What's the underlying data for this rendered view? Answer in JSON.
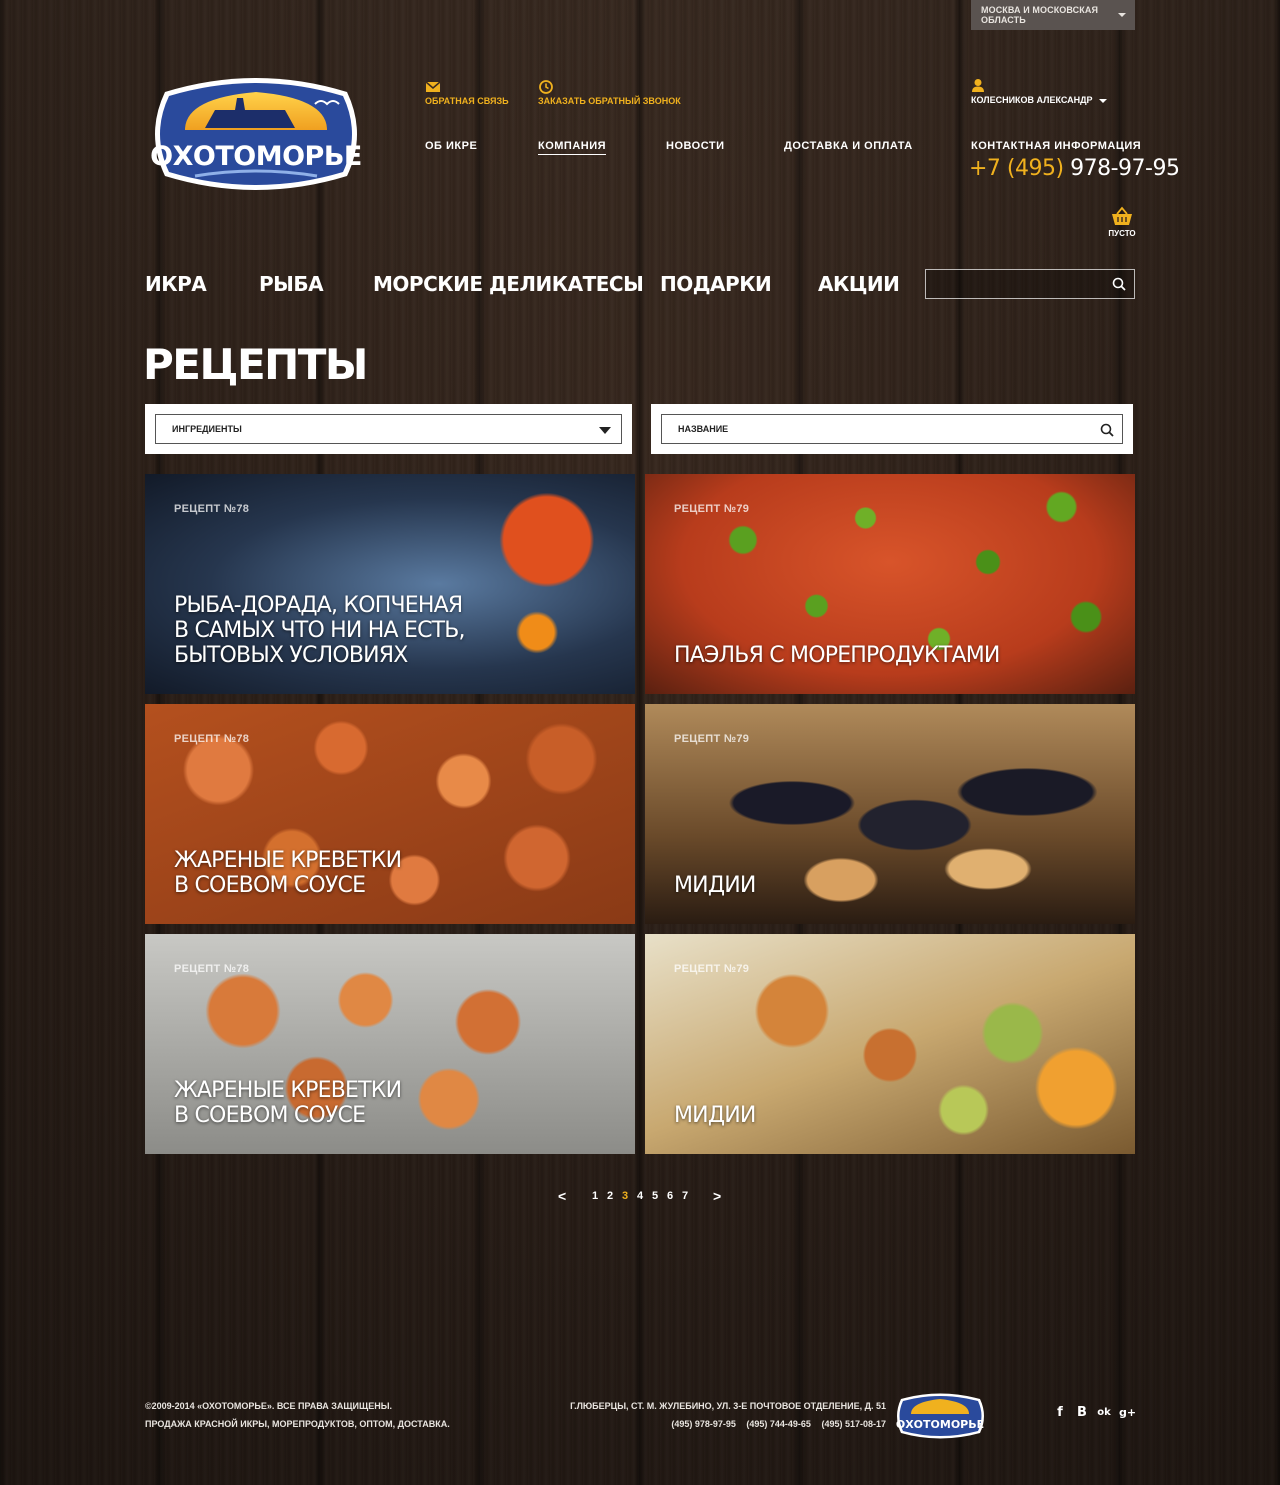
{
  "header": {
    "region": "МОСКВА И МОСКОВСКАЯ ОБЛАСТЬ",
    "logo_text": "ОХОТОМОРЬЕ",
    "feedback_link": "ОБРАТНАЯ СВЯЗЬ",
    "callback_link": "ЗАКАЗАТЬ ОБРАТНЫЙ ЗВОНОК",
    "user_name": "КОЛЕСНИКОВ АЛЕКСАНДР",
    "top_menu": [
      "ОБ ИКРЕ",
      "КОМПАНИЯ",
      "НОВОСТИ",
      "ДОСТАВКА И ОПЛАТА"
    ],
    "active_top_menu": "КОМПАНИЯ",
    "contact_label": "КОНТАКТНАЯ ИНФОРМАЦИЯ",
    "phone_code": "+7 (495)",
    "phone_number": "978-97-95",
    "cart_status": "ПУСТО"
  },
  "main_nav": [
    "ИКРА",
    "РЫБА",
    "МОРСКИЕ ДЕЛИКАТЕСЫ",
    "ПОДАРКИ",
    "АКЦИИ"
  ],
  "search": {
    "placeholder": ""
  },
  "page": {
    "title": "РЕЦЕПТЫ"
  },
  "filters": {
    "ingredients_label": "ИНГРЕДИЕНТЫ",
    "name_label": "НАЗВАНИЕ"
  },
  "recipes": [
    {
      "number": "РЕЦЕПТ №78",
      "title": "РЫБА-ДОРАДА, КОПЧЕНАЯ\nВ САМЫХ ЧТО НИ НА ЕСТЬ,\nБЫТОВЫХ УСЛОВИЯХ",
      "image": "caviar-spoon"
    },
    {
      "number": "РЕЦЕПТ №79",
      "title": "ПАЭЛЬЯ С МОРЕПРОДУКТАМИ",
      "image": "paella"
    },
    {
      "number": "РЕЦЕПТ №78",
      "title": "ЖАРЕНЫЕ КРЕВЕТКИ\nВ СОЕВОМ СОУСЕ",
      "image": "fried-shrimp"
    },
    {
      "number": "РЕЦЕПТ №79",
      "title": "МИДИИ",
      "image": "mussels"
    },
    {
      "number": "РЕЦЕПТ №78",
      "title": "ЖАРЕНЫЕ КРЕВЕТКИ\nВ СОЕВОМ СОУСЕ",
      "image": "shrimp-skewers"
    },
    {
      "number": "РЕЦЕПТ №79",
      "title": "МИДИИ",
      "image": "shrimp-salad"
    }
  ],
  "pagination": {
    "prev": "<",
    "next": ">",
    "pages": [
      "1",
      "2",
      "3",
      "4",
      "5",
      "6",
      "7"
    ],
    "current": "3"
  },
  "footer": {
    "copyright": "©2009-2014 «ОХОТОМОРЬЕ». ВСЕ ПРАВА ЗАЩИЩЕНЫ.",
    "seo_text": "ПРОДАЖА КРАСНОЙ ИКРЫ, МОРЕПРОДУКТОВ, ОПТОМ, ДОСТАВКА.",
    "address": "Г.ЛЮБЕРЦЫ, СТ. М. ЖУЛЕБИНО, УЛ. 3-Е ПОЧТОВОЕ ОТДЕЛЕНИЕ, Д. 51",
    "phones": [
      "(495) 978-97-95",
      "(495) 744-49-65",
      "(495) 517-08-17"
    ],
    "logo_text": "ОХОТОМОРЬЕ",
    "social": [
      {
        "icon": "facebook-icon",
        "glyph": "f"
      },
      {
        "icon": "vkontakte-icon",
        "glyph": "B"
      },
      {
        "icon": "odnoklassniki-icon",
        "glyph": "ok"
      },
      {
        "icon": "google-plus-icon",
        "glyph": "g+"
      }
    ]
  },
  "colors": {
    "accent": "#f0b11e",
    "logo_blue": "#2a4a9c",
    "region_bg": "#5a5350"
  }
}
